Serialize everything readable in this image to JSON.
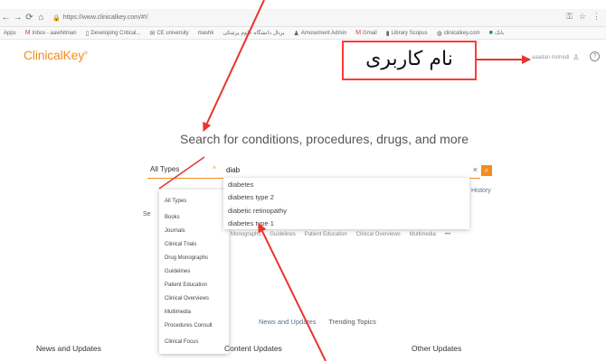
{
  "browser": {
    "url": "https://www.clinicalkey.com/#!/",
    "bookmarks": [
      "Apps",
      "Inbox - aawhitman",
      "Developing Critical...",
      "CE university",
      "mashk",
      "پرتال دانشگاه علوم پزشکی",
      "Amusement Admin",
      "Gmail",
      "Library Scopus",
      "clinicalkey.com",
      "بانک"
    ]
  },
  "header": {
    "logo": "ClinicalKey",
    "logo_mark": "®",
    "username": "aaadan mohedi"
  },
  "annotation": {
    "label": "نام کاربری",
    "color": "#ff3b3b"
  },
  "search": {
    "headline": "Search for conditions, procedures, drugs, and more",
    "type_selected": "All Types",
    "query": "diab",
    "history_link": "History",
    "search_within_prefix": "Se",
    "filters": [
      "Monographs",
      "Guidelines",
      "Patient Education",
      "Clinical Overviews",
      "Multimedia",
      "•••"
    ]
  },
  "types_menu": {
    "items": [
      "All Types",
      "Books",
      "Journals",
      "Clinical Trials",
      "Drug Monographs",
      "Guidelines",
      "Patient Education",
      "Clinical Overviews",
      "Multimedia",
      "Procedures Consult",
      "Clinical Focus"
    ]
  },
  "suggestions": [
    "diabetes",
    "diabetes type 2",
    "diabetic retinopathy",
    "diabetes type 1"
  ],
  "bottom": {
    "tabs": [
      "News and Updates",
      "Trending Topics"
    ],
    "sections": [
      "News and Updates",
      "Content Updates",
      "Other Updates"
    ]
  }
}
